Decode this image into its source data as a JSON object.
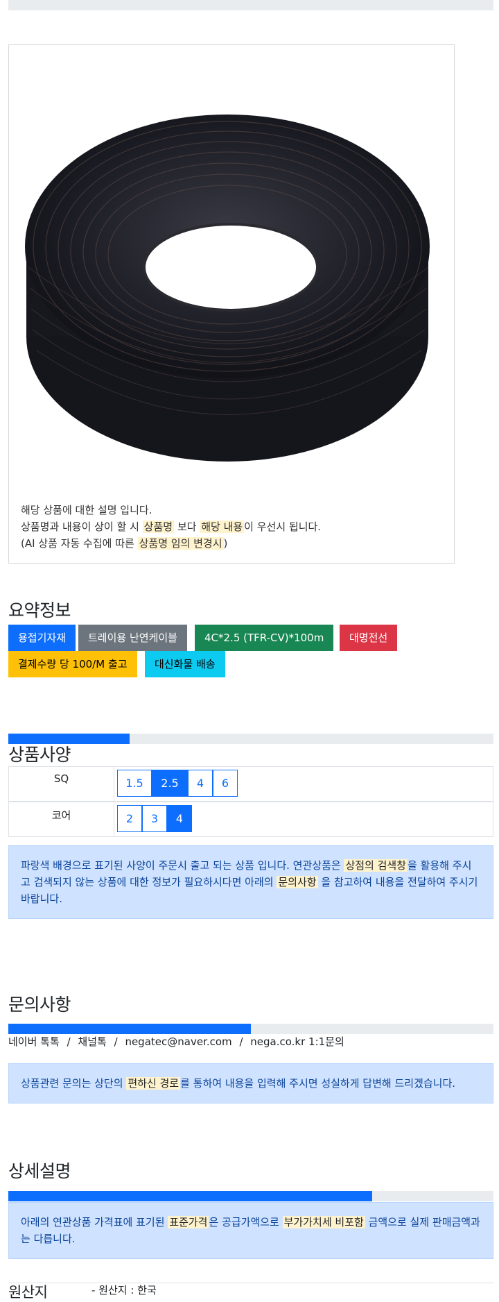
{
  "product": {
    "desc_lines": {
      "line1": "해당 상품에 대한 설명 입니다.",
      "line2_a": "상품명과 내용이 상이 할 시 ",
      "line2_hl1": "상품명",
      "line2_b": " 보다 ",
      "line2_hl2": "해당 내용",
      "line2_c": "이 우선시 됩니다.",
      "line3_a": "(AI 상품 자동 수집에 따른 ",
      "line3_hl": "상품명 임의 변경시",
      "line3_b": ")"
    }
  },
  "summary": {
    "title": "요약정보",
    "tags": [
      {
        "label": "용접기자재",
        "color": "#0d6efd"
      },
      {
        "label": "트레이용 난연케이블",
        "color": "#6c757d"
      },
      {
        "label": "4C*2.5 (TFR-CV)*100m",
        "color": "#198754"
      },
      {
        "label": "대명전선",
        "color": "#dc3545"
      },
      {
        "label": "결제수량 당 100/M 출고",
        "color": "#ffc107"
      },
      {
        "label": "대신화물 배송",
        "color": "#0dcaf0"
      }
    ]
  },
  "specs": {
    "title": "상품사양",
    "progress": 0.25,
    "rows": [
      {
        "label": "SQ",
        "options": [
          "1.5",
          "2.5",
          "4",
          "6"
        ],
        "selected": "2.5"
      },
      {
        "label": "코어",
        "options": [
          "2",
          "3",
          "4"
        ],
        "selected": "4"
      }
    ],
    "notice": {
      "a": "파랑색 배경으로 표기된 사양이 주문시 출고 되는 상품 입니다. 연관상품은 ",
      "hl1": "상점의 검색창",
      "b": "을 활용해 주시고 검색되지 않는 상품에 대한 정보가 필요하시다면 아래의 ",
      "hl2": "문의사항",
      "c": " 을 참고하여 내용을 전달하여 주시기 바랍니다."
    }
  },
  "inquiry": {
    "title": "문의사항",
    "progress": 0.5,
    "links": [
      "네이버 톡톡",
      "채널톡",
      "negatec@naver.com",
      "nega.co.kr 1:1문의"
    ],
    "separator": "/",
    "notice": {
      "a": "상품관련 문의는 상단의 ",
      "hl": "편하신 경로",
      "b": "를 통하여 내용을 입력해 주시면 성실하게 답변해 드리겠습니다."
    }
  },
  "detail": {
    "title": "상세설명",
    "progress": 0.75,
    "notice": {
      "a": "아래의 연관상품 가격표에 표기된 ",
      "hl1": "표준가격",
      "b": "은 공급가액으로 ",
      "hl2": "부가가치세 비포함",
      "c": " 금액으로 실제 판매금액과는 다릅니다."
    }
  },
  "origin": {
    "title": "원산지",
    "value": "- 원산지 : 한국"
  }
}
